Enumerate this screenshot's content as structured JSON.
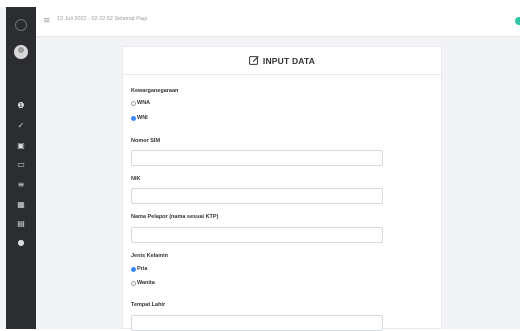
{
  "header": {
    "date_text": "13 Juli 2022 - 02:22:52 Selamat Pagi"
  },
  "sidebar": {
    "items": [
      {
        "icon": "dashboard-icon",
        "glyph": "❶"
      },
      {
        "icon": "check-icon",
        "glyph": "✓"
      },
      {
        "icon": "id-card-icon",
        "glyph": "▣"
      },
      {
        "icon": "inbox-icon",
        "glyph": "▭"
      },
      {
        "icon": "list-icon",
        "glyph": "≡"
      },
      {
        "icon": "grid-icon",
        "glyph": "▦"
      },
      {
        "icon": "document-icon",
        "glyph": "▤"
      },
      {
        "icon": "users-icon",
        "glyph": "●"
      }
    ]
  },
  "form": {
    "title": "INPUT DATA",
    "kewarganegaraan_label": "Kewarganegaraan",
    "kewarganegaraan_options": [
      {
        "label": "WNA",
        "selected": false
      },
      {
        "label": "WNI",
        "selected": true
      }
    ],
    "sim_label": "Nomor SIM",
    "sim_value": "",
    "nik_label": "NIK",
    "nik_value": "",
    "pelapor_label": "Nama Pelapor   (nama sesuai KTP)",
    "pelapor_value": "",
    "gender_label": "Jenis Kelamin",
    "gender_options": [
      {
        "label": "Pria",
        "selected": true
      },
      {
        "label": "Wanita",
        "selected": false
      }
    ],
    "tempat_lahir_label": "Tempat Lahir",
    "tempat_lahir_value": ""
  },
  "colors": {
    "accent": "#3a86ff",
    "sidebar": "#2b2d31",
    "status": "#2fc4a3"
  }
}
